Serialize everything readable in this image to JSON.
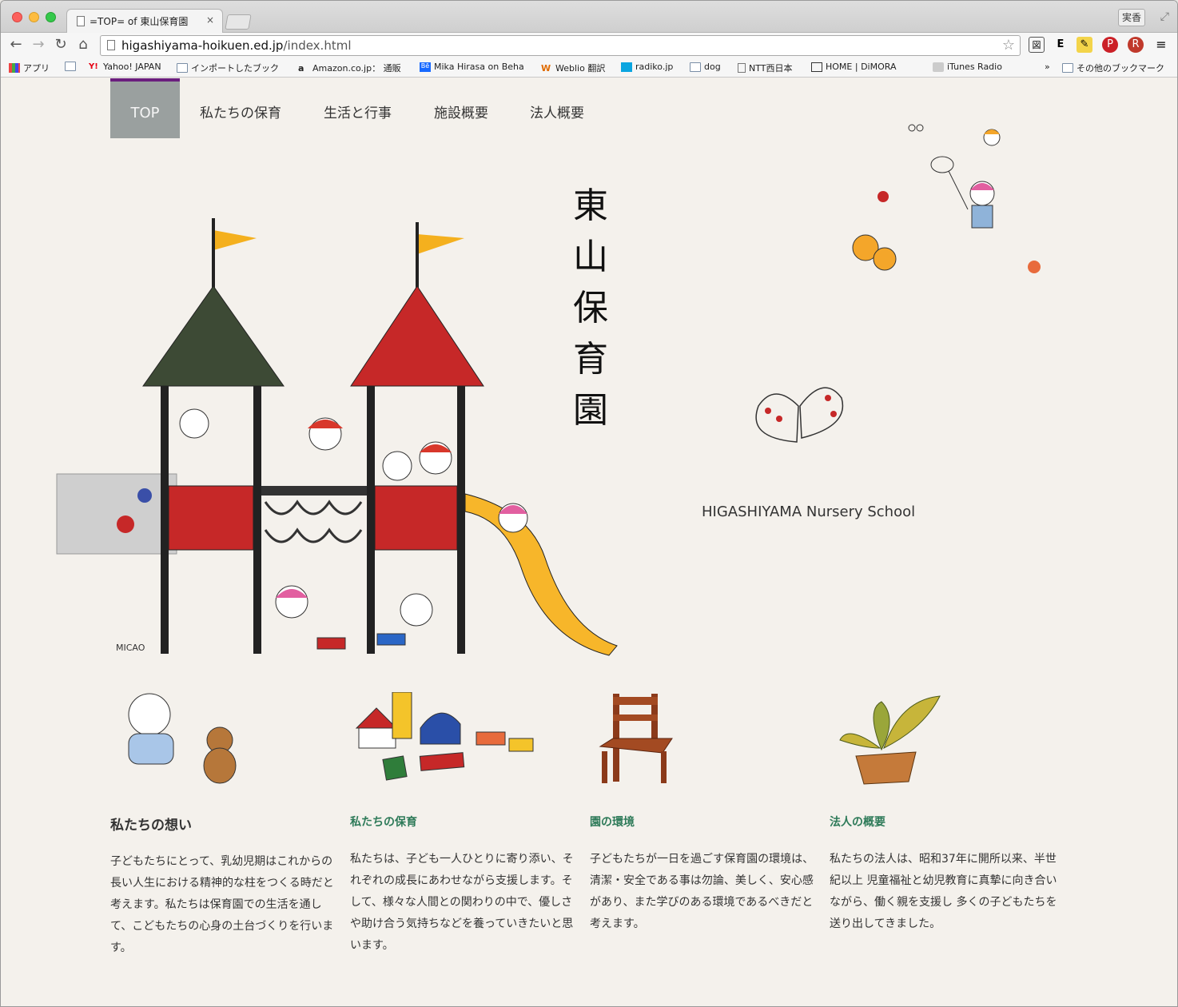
{
  "browser": {
    "tab_title": "=TOP= of 東山保育園",
    "tab_close": "×",
    "profile_label": "実香",
    "url_host": "higashiyama-hoikuen.ed.jp",
    "url_path": "/index.html",
    "bookmarks": [
      "アプリ",
      "Yahoo! JAPAN",
      "インポートしたブック",
      "Amazon.co.jp： 通販",
      "Mika Hirasa on Beha",
      "Weblio 翻訳",
      "radiko.jp",
      "dog",
      "NTT西日本",
      "HOME | DiMORA",
      "iTunes Radio"
    ],
    "bookmarks_overflow": "»",
    "other_bookmarks": "その他のブックマーク"
  },
  "nav": {
    "items": [
      "TOP",
      "私たちの保育",
      "生活と行事",
      "施設概要",
      "法人概要"
    ]
  },
  "hero": {
    "title_chars": [
      "東",
      "山",
      "保",
      "育",
      "園"
    ],
    "subtitle": "HIGASHIYAMA Nursery School",
    "artist_signature": "MICAO"
  },
  "sections": [
    {
      "heading": "私たちの想い",
      "body": "子どもたちにとって、乳幼児期はこれからの長い人生における精神的な柱をつくる時だと考えます。私たちは保育園での生活を通して、こどもたちの心身の土台づくりを行います。"
    },
    {
      "heading": "私たちの保育",
      "body": "私たちは、子ども一人ひとりに寄り添い、それぞれの成長にあわせながら支援します。そして、様々な人間との関わりの中で、優しさや助け合う気持ちなどを養っていきたいと思います。"
    },
    {
      "heading": "園の環境",
      "body": "子どもたちが一日を過ごす保育園の環境は、清潔・安全である事は勿論、美しく、安心感があり、また学びのある環境であるべきだと考えます。"
    },
    {
      "heading": "法人の概要",
      "body": "私たちの法人は、昭和37年に開所以来、半世紀以上 児童福祉と幼児教育に真摯に向き合いながら、働く親を支援し 多くの子どもたちを送り出してきました。"
    }
  ],
  "colors": {
    "nav_active_bg": "#9aa09f",
    "nav_active_border": "#6b1e7e",
    "section_link_green": "#2d7a58",
    "page_bg": "#f4f1ec"
  }
}
